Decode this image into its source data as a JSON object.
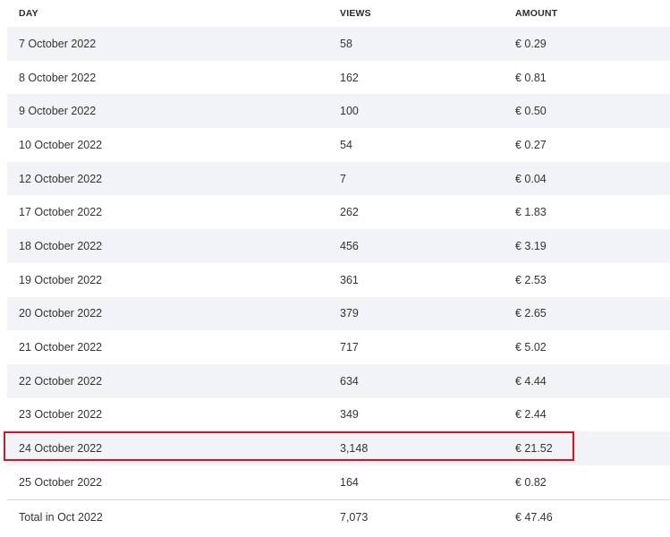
{
  "table": {
    "headers": {
      "day": "DAY",
      "views": "VIEWS",
      "amount": "AMOUNT"
    },
    "rows": [
      {
        "day": "7 October 2022",
        "views": "58",
        "amount": "€ 0.29"
      },
      {
        "day": "8 October 2022",
        "views": "162",
        "amount": "€ 0.81"
      },
      {
        "day": "9 October 2022",
        "views": "100",
        "amount": "€ 0.50"
      },
      {
        "day": "10 October 2022",
        "views": "54",
        "amount": "€ 0.27"
      },
      {
        "day": "12 October 2022",
        "views": "7",
        "amount": "€ 0.04"
      },
      {
        "day": "17 October 2022",
        "views": "262",
        "amount": "€ 1.83"
      },
      {
        "day": "18 October 2022",
        "views": "456",
        "amount": "€ 3.19"
      },
      {
        "day": "19 October 2022",
        "views": "361",
        "amount": "€ 2.53"
      },
      {
        "day": "20 October 2022",
        "views": "379",
        "amount": "€ 2.65"
      },
      {
        "day": "21 October 2022",
        "views": "717",
        "amount": "€ 5.02"
      },
      {
        "day": "22 October 2022",
        "views": "634",
        "amount": "€ 4.44"
      },
      {
        "day": "23 October 2022",
        "views": "349",
        "amount": "€ 2.44"
      },
      {
        "day": "24 October 2022",
        "views": "3,148",
        "amount": "€ 21.52"
      },
      {
        "day": "25 October 2022",
        "views": "164",
        "amount": "€ 0.82"
      }
    ],
    "total": {
      "day": "Total in Oct 2022",
      "views": "7,073",
      "amount": "€ 47.46"
    }
  },
  "colors": {
    "stripe": "#f1f3f6",
    "highlight_border": "#e0101f"
  }
}
